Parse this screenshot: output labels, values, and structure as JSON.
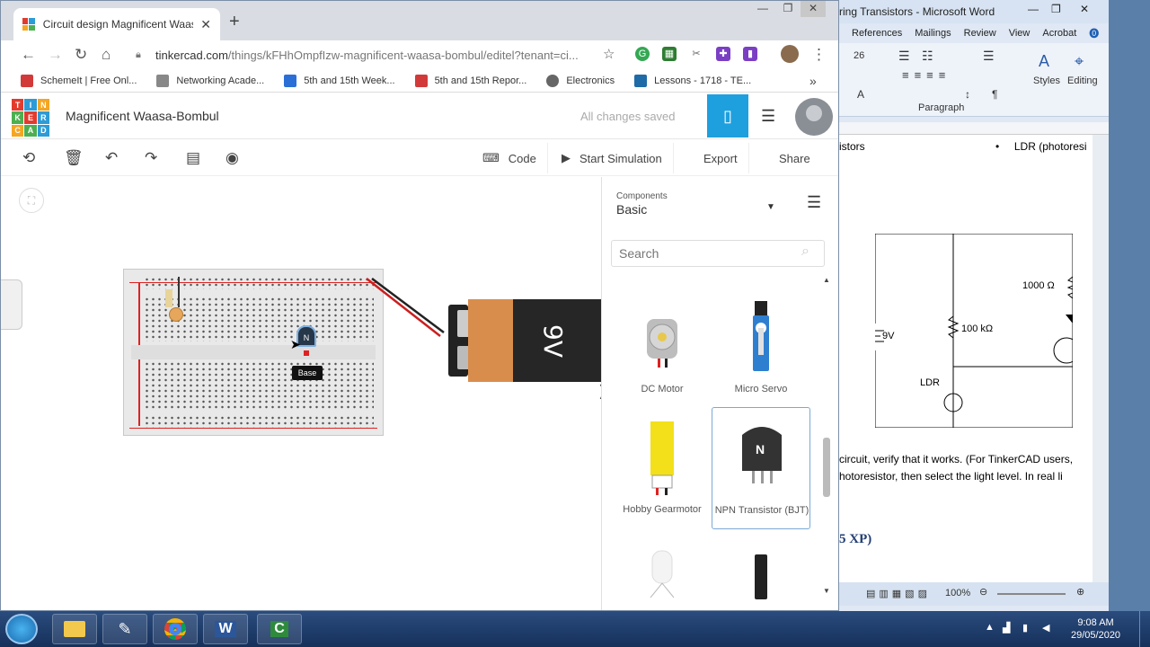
{
  "browser": {
    "tab_title": "Circuit design Magnificent Waasa-Bombul",
    "tab_close": "✕",
    "new_tab": "+",
    "url_host": "tinkercad.com",
    "url_path": "/things/kFHhOmpfIzw-magnificent-waasa-bombul/editel?tenant=ci...",
    "window_controls": [
      "—",
      "❐",
      "✕"
    ],
    "bookmarks": [
      {
        "label": "SchemeIt | Free Onl...",
        "color": "#d23a3a"
      },
      {
        "label": "Networking Acade...",
        "color": "#888888"
      },
      {
        "label": "5th and 15th Week...",
        "color": "#2b6fd6"
      },
      {
        "label": "5th and 15th Repor...",
        "color": "#d23a3a"
      },
      {
        "label": "Electronics",
        "color": "#666666"
      },
      {
        "label": "Lessons - 1718 - TE...",
        "color": "#1e6ba8"
      }
    ],
    "bookmarks_more": "»"
  },
  "tinkercad": {
    "logo_letters": [
      "TIN",
      "KER",
      "CAD"
    ],
    "design_name": "Magnificent Waasa-Bombul",
    "save_status": "All changes saved",
    "toolbar": {
      "code": "Code",
      "start_simulation": "Start Simulation",
      "export": "Export",
      "share": "Share"
    },
    "tooltip": "Base",
    "transistor_letter": "N",
    "battery_label": "9V",
    "components": {
      "section_label": "Components",
      "selected": "Basic",
      "search_placeholder": "Search",
      "items": [
        {
          "label": "DC Motor"
        },
        {
          "label": "Micro Servo"
        },
        {
          "label": "Hobby Gearmotor"
        },
        {
          "label": "NPN Transistor (BJT)"
        }
      ],
      "npn_letter": "N"
    }
  },
  "word": {
    "title": "ring Transistors - Microsoft Word",
    "ribbon_tabs": [
      "References",
      "Mailings",
      "Review",
      "View",
      "Acrobat"
    ],
    "font_size": "26",
    "styles_label": "Styles",
    "editing_label": "Editing",
    "paragraph_label": "Paragraph",
    "doc_lines": {
      "heading_left": "istors",
      "heading_right": "LDR (photoresi",
      "para1": "circuit, verify that it works.  (For TinkerCAD users,",
      "para2": "hotoresistor, then select the light level.    In real li",
      "heading2": "5 XP)"
    },
    "schematic": {
      "battery": "9V",
      "r1": "1000 Ω",
      "r2": "100 kΩ",
      "ldr": "LDR"
    },
    "zoom": "100%"
  },
  "taskbar": {
    "time": "9:08 AM",
    "date": "29/05/2020"
  }
}
